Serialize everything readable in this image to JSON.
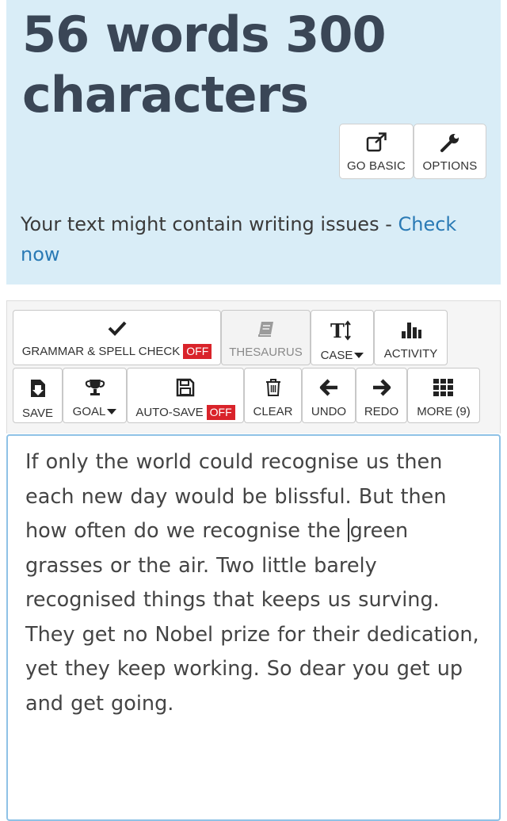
{
  "stats": {
    "headline": "56 words 300 characters"
  },
  "panel_buttons": {
    "go_basic": {
      "label": "GO BASIC",
      "icon": "external-link-icon"
    },
    "options": {
      "label": "OPTIONS",
      "icon": "wrench-icon"
    }
  },
  "writing_issues": {
    "message": "Your text might contain writing issues - ",
    "link": "Check now"
  },
  "toolbar": {
    "grammar": {
      "label": "GRAMMAR & SPELL CHECK",
      "state": "OFF",
      "icon": "checkmark-icon"
    },
    "thesaurus": {
      "label": "THESAURUS",
      "icon": "book-icon"
    },
    "case": {
      "label": "CASE",
      "icon": "text-case-icon"
    },
    "activity": {
      "label": "ACTIVITY",
      "icon": "bar-chart-icon"
    },
    "save": {
      "label": "SAVE",
      "icon": "download-icon"
    },
    "goal": {
      "label": "GOAL",
      "icon": "trophy-icon"
    },
    "autosave": {
      "label": "AUTO-SAVE",
      "state": "OFF",
      "icon": "floppy-disk-icon"
    },
    "clear": {
      "label": "CLEAR",
      "icon": "trash-icon"
    },
    "undo": {
      "label": "UNDO",
      "icon": "arrow-left-icon"
    },
    "redo": {
      "label": "REDO",
      "icon": "arrow-right-icon"
    },
    "more": {
      "label": "MORE (9)",
      "icon": "grid-icon"
    }
  },
  "editor": {
    "text_before_cursor": "If only the world could recognise us then each new day would be blissful. But then how often do we recognise the ",
    "text_after_cursor": "green grasses or the air. Two little barely recognised things that keeps us surving. They get no Nobel prize for their dedication, yet they keep working. So dear you get up and get going."
  },
  "colors": {
    "panel_bg": "#d9edf7",
    "headline": "#3a4656",
    "link": "#2a7ab5",
    "badge_off": "#d9232a",
    "editor_border": "#8fc2e6"
  }
}
